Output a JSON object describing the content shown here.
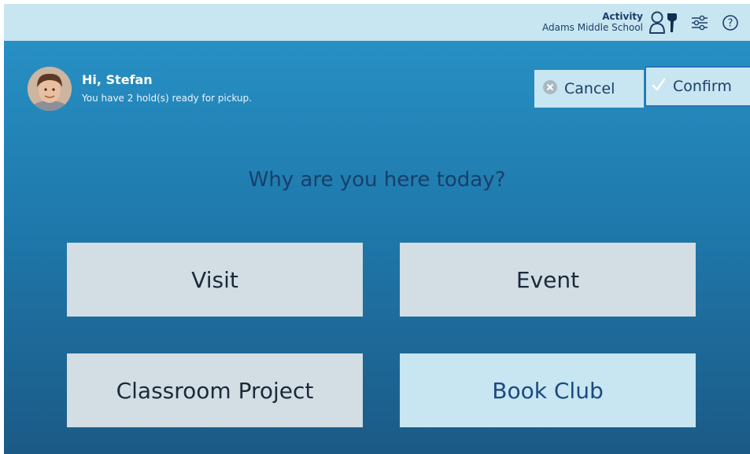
{
  "header": {
    "context_title": "Activity",
    "context_subtitle": "Adams Middle School",
    "icons": [
      "patron-switch-icon",
      "settings-sliders-icon",
      "help-icon"
    ]
  },
  "patron": {
    "greeting": "Hi, Stefan",
    "message": "You have 2 hold(s) ready for pickup."
  },
  "actions": {
    "cancel_label": "Cancel",
    "confirm_label": "Confirm"
  },
  "prompt": "Why are you here today?",
  "choices": [
    {
      "label": "Visit",
      "selected": false
    },
    {
      "label": "Event",
      "selected": false
    },
    {
      "label": "Classroom Project",
      "selected": false
    },
    {
      "label": "Book Club",
      "selected": true
    }
  ],
  "colors": {
    "topbar": "#c7e6f1",
    "background_top": "#2790c4",
    "background_bottom": "#1b5a86",
    "choice_default": "#d3dde4",
    "choice_selected": "#c7e6f1",
    "text_dark": "#1b3f68"
  }
}
